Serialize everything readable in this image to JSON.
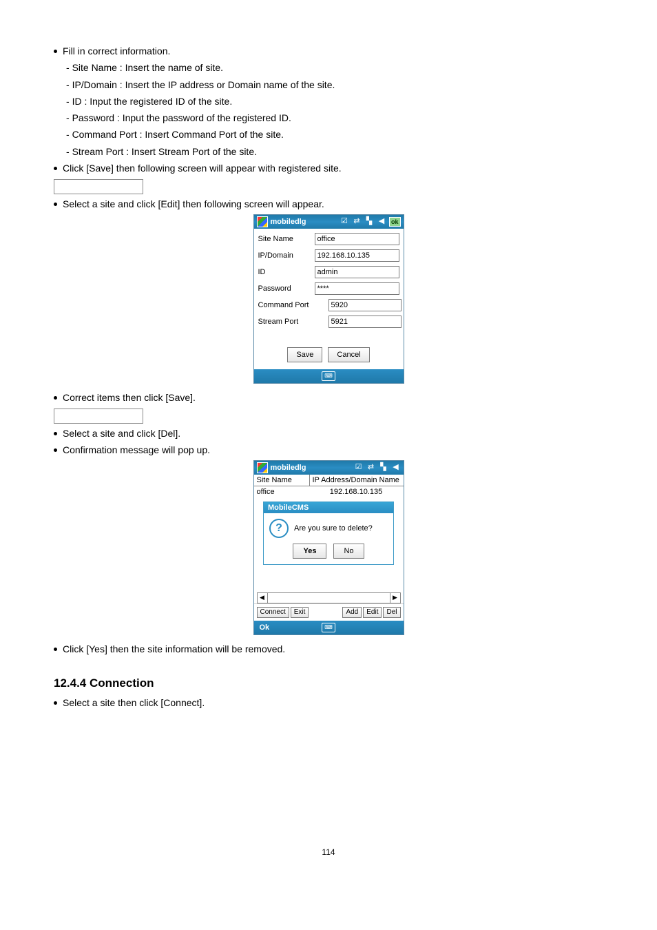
{
  "text": {
    "fill_in": "Fill in correct information.",
    "site_name_desc": "Site Name : Insert the name of site.",
    "ip_domain_desc": "IP/Domain : Insert the IP address or Domain name of the site.",
    "id_desc": "ID : Input the registered ID of the site.",
    "password_desc": "Password : Input the password of the registered ID.",
    "command_port_desc": "Command Port : Insert Command Port of the site.",
    "stream_port_desc": "Stream Port : Insert Stream Port of the site.",
    "click_save": "Click [Save] then following screen will appear with registered site.",
    "select_edit": "Select a site and click [Edit] then following screen will appear.",
    "correct_items": "Correct items then click [Save].",
    "select_del": "Select a site and click [Del].",
    "confirm_popup": "Confirmation message will pop up.",
    "click_yes": "Click [Yes] then the site information will be removed.",
    "section_heading": "12.4.4  Connection",
    "select_connect": "Select a site then click [Connect].",
    "page_number": "114"
  },
  "edit_dialog": {
    "title": "mobiledlg",
    "ok_tag": "ok",
    "labels": {
      "site_name": "Site Name",
      "ip_domain": "IP/Domain",
      "id": "ID",
      "password": "Password",
      "command_port": "Command Port",
      "stream_port": "Stream Port"
    },
    "values": {
      "site_name": "office",
      "ip_domain": "192.168.10.135",
      "id": "admin",
      "password": "****",
      "command_port": "5920",
      "stream_port": "5921"
    },
    "buttons": {
      "save": "Save",
      "cancel": "Cancel"
    }
  },
  "delete_dialog": {
    "title": "mobiledlg",
    "columns": {
      "c1": "Site Name",
      "c2": "IP Address/Domain Name"
    },
    "row": {
      "c1": "office",
      "c2": "192.168.10.135"
    },
    "popup": {
      "title": "MobileCMS",
      "message": "Are you sure to delete?",
      "yes": "Yes",
      "no": "No"
    },
    "bottom_buttons": {
      "connect": "Connect",
      "exit": "Exit",
      "add": "Add",
      "edit": "Edit",
      "del": "Del"
    },
    "footer_ok": "Ok"
  }
}
